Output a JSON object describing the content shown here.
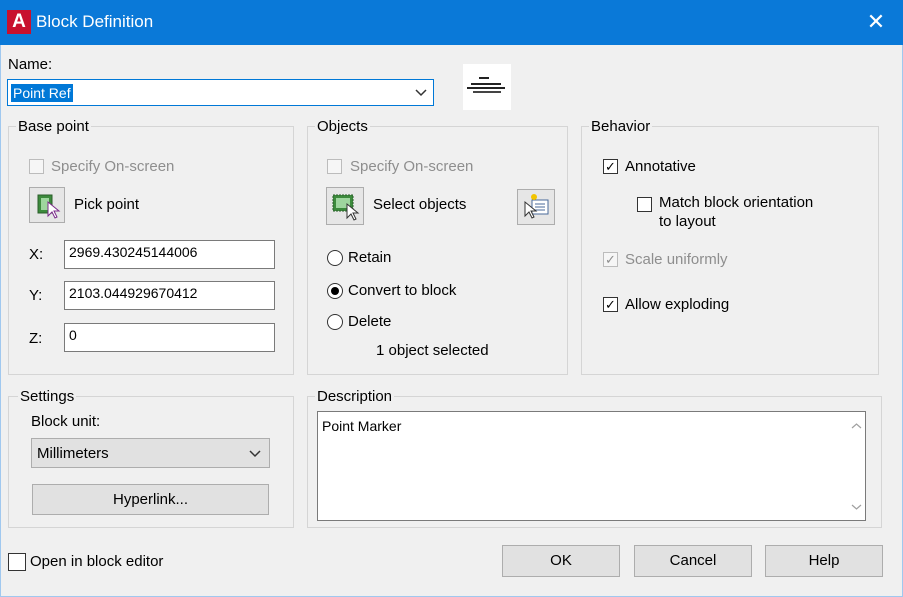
{
  "window": {
    "title": "Block Definition",
    "close_glyph": "✕",
    "app_icon_letter": "A"
  },
  "name": {
    "label": "Name:",
    "value": "Point Ref"
  },
  "base_point": {
    "title": "Base point",
    "specify_on_screen": "Specify On-screen",
    "pick_point": "Pick point",
    "x_label": "X:",
    "x_value": "2969.430245144006",
    "y_label": "Y:",
    "y_value": "2103.044929670412",
    "z_label": "Z:",
    "z_value": "0"
  },
  "objects": {
    "title": "Objects",
    "specify_on_screen": "Specify On-screen",
    "select_objects": "Select objects",
    "retain": "Retain",
    "convert_to_block": "Convert to block",
    "delete": "Delete",
    "selection_status": "1 object selected"
  },
  "behavior": {
    "title": "Behavior",
    "annotative": "Annotative",
    "annotative_checked": true,
    "match_line1": "Match block orientation",
    "match_line2": "to layout",
    "scale_uniformly": "Scale uniformly",
    "allow_exploding": "Allow exploding",
    "allow_exploding_checked": true
  },
  "settings": {
    "title": "Settings",
    "block_unit_label": "Block unit:",
    "block_unit_value": "Millimeters",
    "hyperlink": "Hyperlink..."
  },
  "description": {
    "title": "Description",
    "value": "Point Marker"
  },
  "footer": {
    "open_in_editor": "Open in block editor",
    "ok": "OK",
    "cancel": "Cancel",
    "help": "Help"
  }
}
